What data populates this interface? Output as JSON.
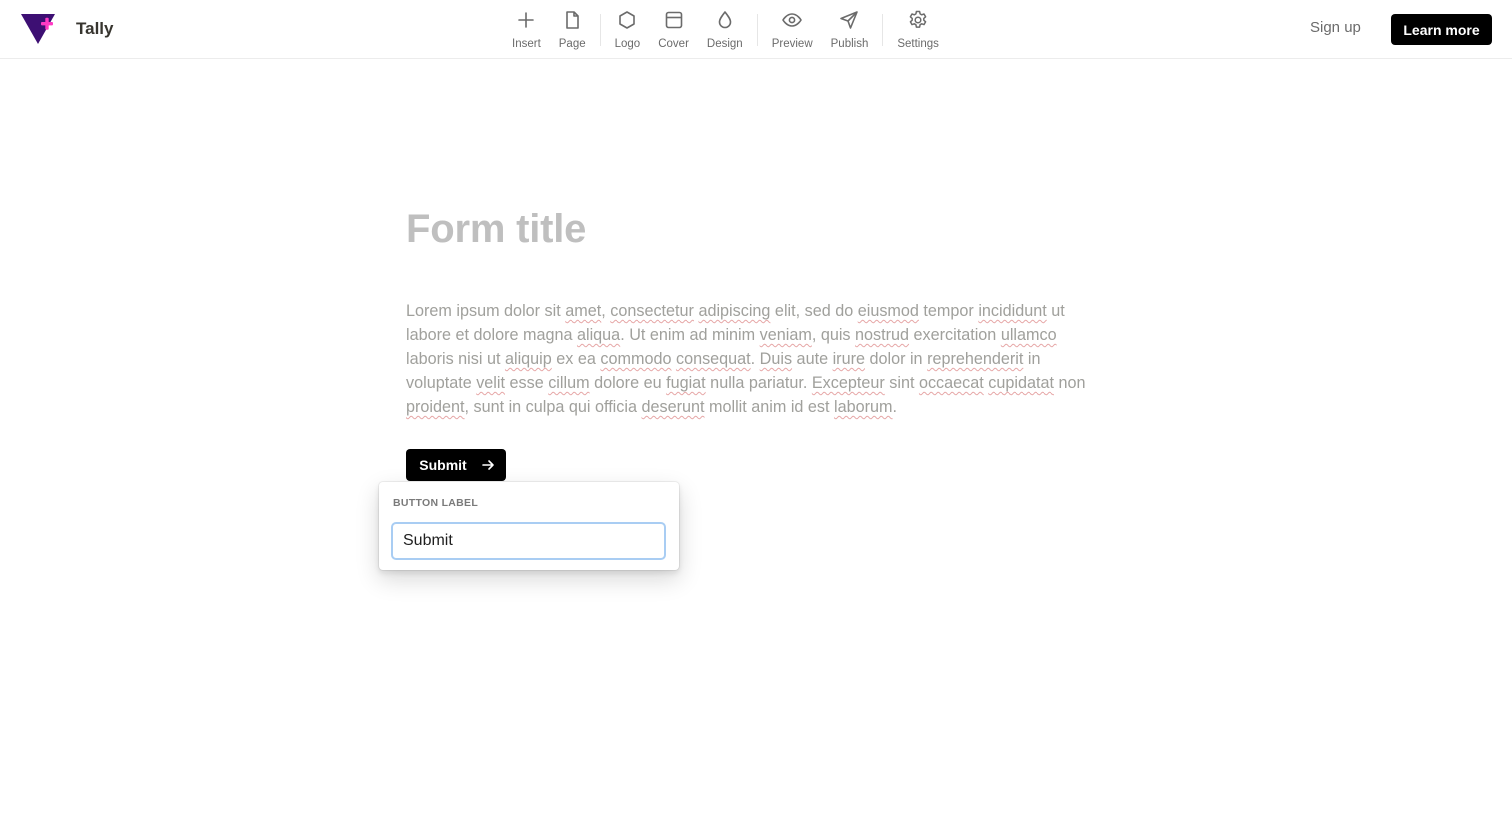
{
  "app": {
    "name": "Tally",
    "accent_colors": {
      "logo_purple": "#3d0f73",
      "logo_pink": "#ff3ac4"
    }
  },
  "toolbar": {
    "items": [
      {
        "label": "Insert",
        "icon": "plus-icon"
      },
      {
        "label": "Page",
        "icon": "page-icon"
      },
      {
        "label": "Logo",
        "icon": "hexagon-icon"
      },
      {
        "label": "Cover",
        "icon": "cover-icon"
      },
      {
        "label": "Design",
        "icon": "droplet-icon"
      },
      {
        "label": "Preview",
        "icon": "eye-icon"
      },
      {
        "label": "Publish",
        "icon": "send-icon"
      },
      {
        "label": "Settings",
        "icon": "gear-icon"
      }
    ]
  },
  "header": {
    "signup_label": "Sign up",
    "learn_more_label": "Learn more"
  },
  "form": {
    "title_placeholder": "Form title",
    "description": {
      "w1": "Lorem ipsum dolor sit ",
      "s1": "amet",
      "w2": ", ",
      "s2": "consectetur",
      "w3": " ",
      "s3": "adipiscing",
      "w4": " elit, sed do ",
      "s4": "eiusmod",
      "w5": " tempor ",
      "s5": "incididunt",
      "w6": " ut labore et dolore magna ",
      "s6": "aliqua",
      "w7": ". Ut enim ad minim ",
      "s7": "veniam",
      "w8": ", quis ",
      "s8": "nostrud",
      "w9": " exercitation ",
      "s9": "ullamco",
      "w10": " laboris nisi ut ",
      "s10": "aliquip",
      "w11": " ex ea ",
      "s11": "commodo",
      "w12": " ",
      "s12": "consequat",
      "w13": ". ",
      "s13": "Duis",
      "w14": " aute ",
      "s14": "irure",
      "w15": " dolor in ",
      "s15": "reprehenderit",
      "w16": " in voluptate ",
      "s16": "velit",
      "w17": " esse ",
      "s17": "cillum",
      "w18": " dolore eu ",
      "s18": "fugiat",
      "w19": " nulla pariatur. ",
      "s19": "Excepteur",
      "w20": " sint ",
      "s20": "occaecat",
      "w21": " ",
      "s21": "cupidatat",
      "w22": " non ",
      "s22": "proident",
      "w23": ", sunt in culpa qui officia ",
      "s23": "deserunt",
      "w24": " mollit anim id est ",
      "s24": "laborum",
      "w25": "."
    },
    "submit_label": "Submit",
    "submit_icon": "arrow-right-icon"
  },
  "popover": {
    "label": "BUTTON LABEL",
    "input_value": "Submit"
  }
}
